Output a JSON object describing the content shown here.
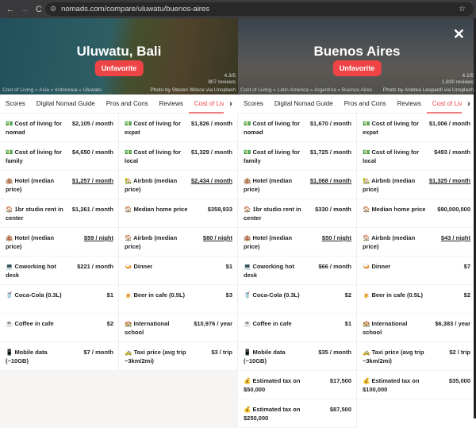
{
  "browser": {
    "url": "nomads.com/compare/uluwatu/buenos-aires",
    "back": "←",
    "forward": "→",
    "reload": "C"
  },
  "close_label": "✕",
  "tabs": [
    "Scores",
    "Digital Nomad Guide",
    "Pros and Cons",
    "Reviews",
    "Cost of Living"
  ],
  "cities": [
    {
      "name": "Uluwatu, Bali",
      "button": "Unfavorite",
      "rating": "4.3/5",
      "reviews": "807 reviews",
      "breadcrumb": "Cost of Living » Asia » Indonesia » Uluwatu",
      "credit": "Photo by Steven Wilcox via Unsplash",
      "rows": [
        [
          "💵",
          "Cost of living for nomad",
          "$2,105 / month",
          false
        ],
        [
          "💵",
          "Cost of living for expat",
          "$1,826 / month",
          false
        ],
        [
          "💵",
          "Cost of living for family",
          "$4,650 / month",
          false
        ],
        [
          "💵",
          "Cost of living for local",
          "$1,329 / month",
          false
        ],
        [
          "🏨",
          "Hotel (median price)",
          "$1,257 / month",
          true
        ],
        [
          "🏡",
          "Airbnb (median price)",
          "$2,434 / month",
          true
        ],
        [
          "🏠",
          "1br studio rent in center",
          "$1,261 / month",
          false
        ],
        [
          "🏠",
          "Median home price",
          "$358,933",
          false
        ],
        [
          "🏨",
          "Hotel (median price)",
          "$59 / night",
          true
        ],
        [
          "🏠",
          "Airbnb (median price)",
          "$80 / night",
          true
        ],
        [
          "💻",
          "Coworking hot desk",
          "$221 / month",
          false
        ],
        [
          "🍛",
          "Dinner",
          "$1",
          false
        ],
        [
          "🥤",
          "Coca-Cola (0.3L)",
          "$1",
          false
        ],
        [
          "🍺",
          "Beer in cafe (0.5L)",
          "$3",
          false
        ],
        [
          "☕",
          "Coffee in cafe",
          "$2",
          false
        ],
        [
          "🏫",
          "International school",
          "$10,976 / year",
          false
        ],
        [
          "📱",
          "Mobile data (~10GB)",
          "$7 / month",
          false
        ],
        [
          "🚕",
          "Taxi price (avg trip ~3km/2mi)",
          "$3 / trip",
          false
        ]
      ]
    },
    {
      "name": "Buenos Aires",
      "button": "Unfavorite",
      "rating": "4.1/5",
      "reviews": "1,830 reviews",
      "breadcrumb": "Cost of Living » Latin America » Argentina » Buenos Aires",
      "credit": "Photo by Andrea Leopardi via Unsplash",
      "rows": [
        [
          "💵",
          "Cost of living for nomad",
          "$1,670 / month",
          false
        ],
        [
          "💵",
          "Cost of living for expat",
          "$1,006 / month",
          false
        ],
        [
          "💵",
          "Cost of living for family",
          "$1,725 / month",
          false
        ],
        [
          "💵",
          "Cost of living for local",
          "$493 / month",
          false
        ],
        [
          "🏨",
          "Hotel (median price)",
          "$1,068 / month",
          true
        ],
        [
          "🏡",
          "Airbnb (median price)",
          "$1,325 / month",
          true
        ],
        [
          "🏠",
          "1br studio rent in center",
          "$330 / month",
          false
        ],
        [
          "🏠",
          "Median home price",
          "$90,000,000",
          false
        ],
        [
          "🏨",
          "Hotel (median price)",
          "$50 / night",
          true
        ],
        [
          "🏠",
          "Airbnb (median price)",
          "$43 / night",
          true
        ],
        [
          "💻",
          "Coworking hot desk",
          "$66 / month",
          false
        ],
        [
          "🍛",
          "Dinner",
          "$7",
          false
        ],
        [
          "🥤",
          "Coca-Cola (0.3L)",
          "$2",
          false
        ],
        [
          "🍺",
          "Beer in cafe (0.5L)",
          "$2",
          false
        ],
        [
          "☕",
          "Coffee in cafe",
          "$1",
          false
        ],
        [
          "🏫",
          "International school",
          "$6,383 / year",
          false
        ],
        [
          "📱",
          "Mobile data (~10GB)",
          "$35 / month",
          false
        ],
        [
          "🚕",
          "Taxi price (avg trip ~3km/2mi)",
          "$2 / trip",
          false
        ],
        [
          "💰",
          "Estimated tax on $50,000",
          "$17,500",
          false
        ],
        [
          "💰",
          "Estimated tax on $100,000",
          "$35,000",
          false
        ],
        [
          "💰",
          "Estimated tax on $250,000",
          "$87,500",
          false
        ]
      ]
    }
  ]
}
